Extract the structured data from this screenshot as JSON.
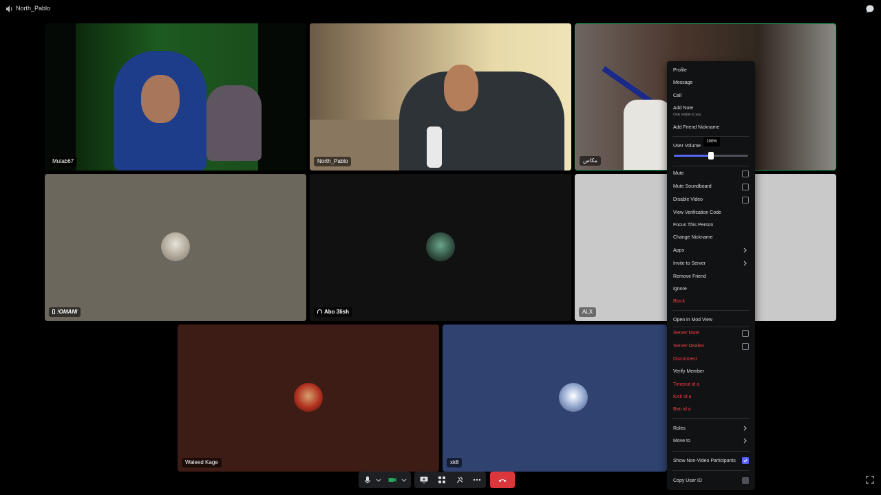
{
  "topbar": {
    "channel_title": "North_Pablo",
    "speaker_icon": "speaker-icon",
    "chat_icon": "chat-bubble-icon"
  },
  "tiles": [
    {
      "name": "Mutab67",
      "bg": "#1b4d1b"
    },
    {
      "name": "North_Pablo",
      "bg": "#7a6a50"
    },
    {
      "name": "مكاس",
      "bg": "#5a4a40"
    },
    {
      "name": "!OMANI",
      "bg": "#6b675d"
    },
    {
      "name": "Abo 3lish",
      "bg": "#111111"
    },
    {
      "name": "ALX",
      "bg": "#c9c9c9"
    },
    {
      "name": "Waleed Kage",
      "bg": "#3d1c16"
    },
    {
      "name": "xk8",
      "bg": "#2f4270"
    }
  ],
  "menu": {
    "profile": "Profile",
    "message": "Message",
    "call": "Call",
    "add_note": "Add Note",
    "add_note_sub": "Only visible to you",
    "add_friend_nickname": "Add Friend Nickname",
    "user_volume": "User Volume",
    "volume_tooltip": "100%",
    "volume_level_percent": 100,
    "mute": "Mute",
    "mute_soundboard": "Mute Soundboard",
    "disable_video": "Disable Video",
    "view_verification_code": "View Verification Code",
    "focus_this_person": "Focus This Person",
    "change_nickname": "Change Nickname",
    "apps": "Apps",
    "invite_to_server": "Invite to Server",
    "remove_friend": "Remove Friend",
    "ignore": "Ignore",
    "block": "Block",
    "open_in_mod_view": "Open in Mod View",
    "server_mute": "Server Mute",
    "server_deafen": "Server Deafen",
    "disconnect": "Disconnect",
    "verify_member": "Verify Member",
    "timeout": "Timeout id a",
    "kick": "Kick id a",
    "ban": "Ban id a",
    "roles": "Roles",
    "move_to": "Move to",
    "show_non_video": "Show Non-Video Participants",
    "show_non_video_checked": true,
    "copy_user_id": "Copy User ID"
  },
  "controls": {
    "mic_icon": "microphone-icon",
    "camera_icon": "camera-icon",
    "screenshare_icon": "screen-share-icon",
    "activities_icon": "activities-icon",
    "soundboard_icon": "soundboard-icon",
    "more_icon": "more-icon",
    "end_call_icon": "end-call-icon",
    "fullscreen_icon": "fullscreen-icon"
  },
  "colors": {
    "accent": "#5865f2",
    "danger": "#f23f42",
    "end_call": "#da373c",
    "menu_bg": "#111214"
  }
}
